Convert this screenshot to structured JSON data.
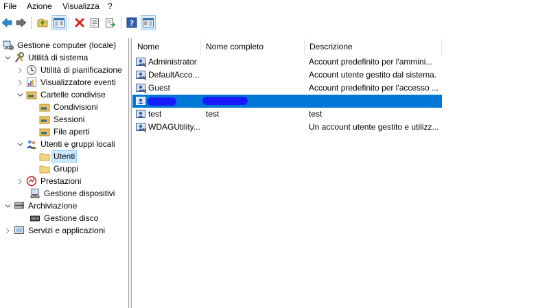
{
  "menu": [
    "File",
    "Azione",
    "Visualizza",
    "?"
  ],
  "toolbar": {
    "buttons": [
      "back-icon",
      "forward-icon",
      "up-folder-icon",
      "show-hide-tree-icon",
      "delete-icon",
      "properties-icon",
      "export-list-icon",
      "help-icon",
      "action-pane-icon"
    ]
  },
  "tree": {
    "items": [
      {
        "label": "Gestione computer (locale)",
        "icon": "computer-management-icon"
      },
      {
        "label": "Utilità di sistema",
        "icon": "system-tools-icon"
      },
      {
        "label": "Utilità di pianificazione",
        "icon": "task-scheduler-icon"
      },
      {
        "label": "Visualizzatore eventi",
        "icon": "event-viewer-icon"
      },
      {
        "label": "Cartelle condivise",
        "icon": "shared-folders-icon"
      },
      {
        "label": "Condivisioni",
        "icon": "shares-icon"
      },
      {
        "label": "Sessioni",
        "icon": "sessions-icon"
      },
      {
        "label": "File aperti",
        "icon": "open-files-icon"
      },
      {
        "label": "Utenti e gruppi locali",
        "icon": "local-users-groups-icon"
      },
      {
        "label": "Utenti",
        "icon": "folder-icon"
      },
      {
        "label": "Gruppi",
        "icon": "folder-icon"
      },
      {
        "label": "Prestazioni",
        "icon": "performance-icon"
      },
      {
        "label": "Gestione dispositivi",
        "icon": "device-manager-icon"
      },
      {
        "label": "Archiviazione",
        "icon": "storage-icon"
      },
      {
        "label": "Gestione disco",
        "icon": "disk-management-icon"
      },
      {
        "label": "Servizi e applicazioni",
        "icon": "services-applications-icon"
      }
    ]
  },
  "list": {
    "columns": [
      "Nome",
      "Nome completo",
      "Descrizione"
    ],
    "rows": [
      {
        "name": "Administrator",
        "full_name": "",
        "description": "Account predefinito per l'ammini..."
      },
      {
        "name": "DefaultAcco...",
        "full_name": "",
        "description": "Account utente gestito dal sistema."
      },
      {
        "name": "Guest",
        "full_name": "",
        "description": "Account predefinito per l'accesso ..."
      },
      {
        "name": "",
        "full_name": "",
        "description": ""
      },
      {
        "name": "test",
        "full_name": "test",
        "description": "test"
      },
      {
        "name": "WDAGUtility...",
        "full_name": "",
        "description": "Un account utente gestito e utilizz..."
      }
    ]
  },
  "colors": {
    "selection": "#0078d7",
    "tree_selection": "#cce8ff",
    "redaction": "#1a1aff"
  }
}
